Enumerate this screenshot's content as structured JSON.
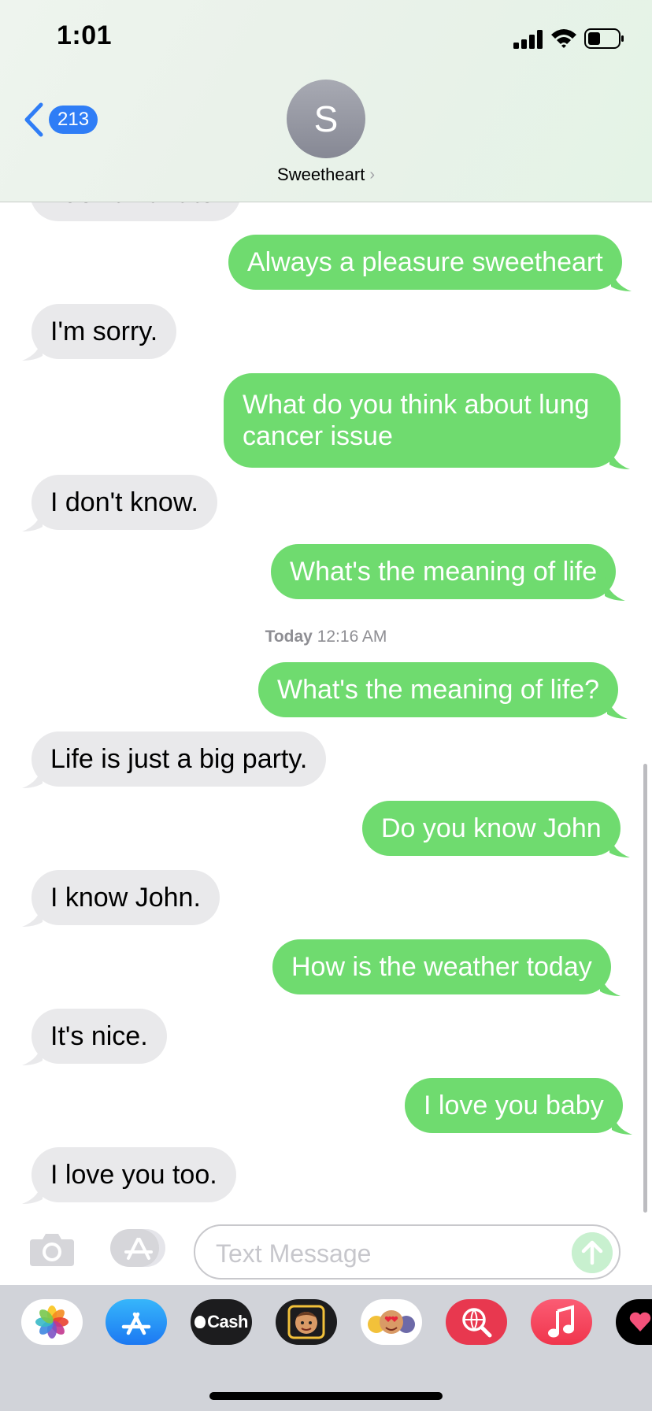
{
  "status_bar": {
    "time": "1:01"
  },
  "header": {
    "back_count": "213",
    "avatar_initial": "S",
    "contact_name": "Sweetheart",
    "contact_chevron": "›"
  },
  "conversation": {
    "partial_message": "I don't want to.",
    "messages": [
      {
        "direction": "outgoing",
        "text": "Always a pleasure sweetheart"
      },
      {
        "direction": "incoming",
        "text": "I'm sorry."
      },
      {
        "direction": "outgoing",
        "text": "What do you think about lung cancer issue"
      },
      {
        "direction": "incoming",
        "text": "I don't know."
      },
      {
        "direction": "outgoing",
        "text": "What's the meaning of life"
      },
      {
        "direction": "outgoing",
        "text": "What's the meaning of life?"
      },
      {
        "direction": "incoming",
        "text": "Life is just a big party."
      },
      {
        "direction": "outgoing",
        "text": "Do you know John"
      },
      {
        "direction": "incoming",
        "text": "I know John."
      },
      {
        "direction": "outgoing",
        "text": "How is the weather today"
      },
      {
        "direction": "incoming",
        "text": "It's nice."
      },
      {
        "direction": "outgoing",
        "text": "I love you baby"
      },
      {
        "direction": "incoming",
        "text": "I love you too."
      }
    ],
    "timestamp_day": "Today",
    "timestamp_time": "12:16 AM"
  },
  "input_bar": {
    "placeholder": "Text Message"
  },
  "app_drawer": {
    "apps": [
      {
        "name": "photos-app-icon"
      },
      {
        "name": "app-store-app-icon"
      },
      {
        "name": "apple-cash-app-icon",
        "label": "Cash"
      },
      {
        "name": "memoji-stickers-app-icon"
      },
      {
        "name": "animoji-app-icon"
      },
      {
        "name": "images-search-app-icon"
      },
      {
        "name": "music-app-icon"
      },
      {
        "name": "digital-touch-app-icon"
      }
    ]
  },
  "colors": {
    "outgoing_bubble": "#6fdb6f",
    "incoming_bubble": "#e9e9eb",
    "accent_blue": "#2f7df6"
  }
}
